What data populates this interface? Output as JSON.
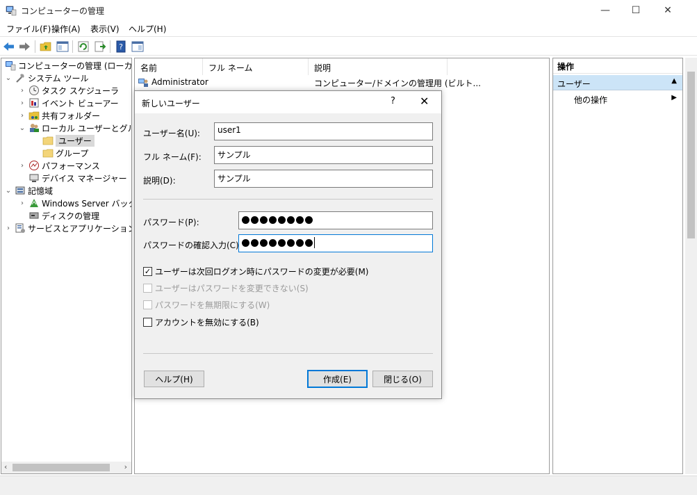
{
  "window": {
    "title": "コンピューターの管理",
    "minimize": "—",
    "maximize": "☐",
    "close": "✕"
  },
  "menu": [
    "ファイル(F)",
    "操作(A)",
    "表示(V)",
    "ヘルプ(H)"
  ],
  "tree": {
    "root": "コンピューターの管理 (ローカル)",
    "system_tools": "システム ツール",
    "task_scheduler": "タスク スケジューラ",
    "event_viewer": "イベント ビューアー",
    "shared_folders": "共有フォルダー",
    "local_users_groups": "ローカル ユーザーとグループ",
    "users": "ユーザー",
    "groups": "グループ",
    "performance": "パフォーマンス",
    "device_manager": "デバイス マネージャー",
    "storage": "記憶域",
    "windows_server_backup": "Windows Server バックア",
    "disk_management": "ディスクの管理",
    "services_apps": "サービスとアプリケーション"
  },
  "list": {
    "columns": [
      "名前",
      "フル ネーム",
      "説明"
    ],
    "rows": [
      {
        "name": "Administrator",
        "fullname": "",
        "description": "コンピューター/ドメインの管理用 (ビルト..."
      }
    ]
  },
  "actions": {
    "header": "操作",
    "section": "ユーザー",
    "other": "他の操作"
  },
  "dialog": {
    "title": "新しいユーザー",
    "help_icon": "?",
    "close_icon": "✕",
    "username_label": "ユーザー名(U):",
    "username_value": "user1",
    "fullname_label": "フル ネーム(F):",
    "fullname_value": "サンプル",
    "description_label": "説明(D):",
    "description_value": "サンプル",
    "password_label": "パスワード(P):",
    "password_dots": 8,
    "confirm_label": "パスワードの確認入力(C):",
    "confirm_dots": 8,
    "chk_must_change": "ユーザーは次回ログオン時にパスワードの変更が必要(M)",
    "chk_must_change_checked": true,
    "chk_cannot_change": "ユーザーはパスワードを変更できない(S)",
    "chk_never_expires": "パスワードを無期限にする(W)",
    "chk_disabled": "アカウントを無効にする(B)",
    "help_button": "ヘルプ(H)",
    "create_button": "作成(E)",
    "close_button": "閉じる(O)"
  }
}
